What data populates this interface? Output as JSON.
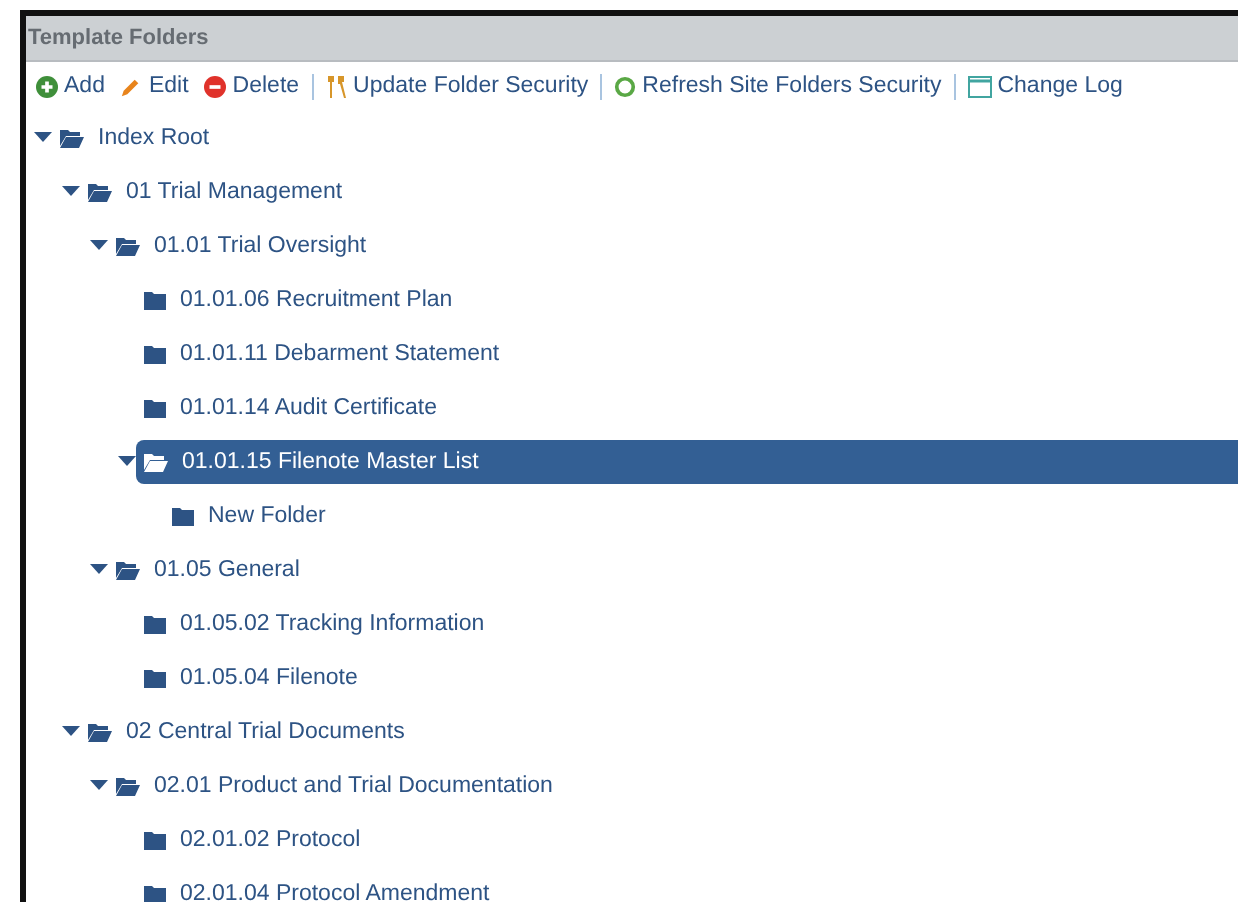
{
  "panel": {
    "title": "Template Folders"
  },
  "toolbar": [
    {
      "kind": "add",
      "label": "Add"
    },
    {
      "kind": "edit",
      "label": "Edit"
    },
    {
      "kind": "delete",
      "label": "Delete",
      "separator_after": true
    },
    {
      "kind": "security",
      "label": "Update Folder Security",
      "separator_after": true
    },
    {
      "kind": "refresh",
      "label": "Refresh Site Folders Security",
      "separator_after": true
    },
    {
      "kind": "log",
      "label": "Change Log"
    }
  ],
  "tree": [
    {
      "label": "Index Root",
      "expanded": true,
      "selected": false,
      "children": [
        {
          "label": "01 Trial Management",
          "expanded": true,
          "selected": false,
          "children": [
            {
              "label": "01.01 Trial Oversight",
              "expanded": true,
              "selected": false,
              "children": [
                {
                  "label": "01.01.06 Recruitment Plan",
                  "selected": false
                },
                {
                  "label": "01.01.11 Debarment Statement",
                  "selected": false
                },
                {
                  "label": "01.01.14 Audit Certificate",
                  "selected": false
                },
                {
                  "label": "01.01.15 Filenote Master List",
                  "expanded": true,
                  "selected": true,
                  "children": [
                    {
                      "label": "New Folder",
                      "selected": false
                    }
                  ]
                }
              ]
            },
            {
              "label": "01.05 General",
              "expanded": true,
              "selected": false,
              "children": [
                {
                  "label": "01.05.02 Tracking Information",
                  "selected": false
                },
                {
                  "label": "01.05.04 Filenote",
                  "selected": false
                }
              ]
            }
          ]
        },
        {
          "label": "02 Central Trial Documents",
          "expanded": true,
          "selected": false,
          "children": [
            {
              "label": "02.01 Product and Trial Documentation",
              "expanded": true,
              "selected": false,
              "children": [
                {
                  "label": "02.01.02 Protocol",
                  "selected": false
                },
                {
                  "label": "02.01.04 Protocol Amendment",
                  "selected": false
                }
              ]
            }
          ]
        }
      ]
    }
  ]
}
